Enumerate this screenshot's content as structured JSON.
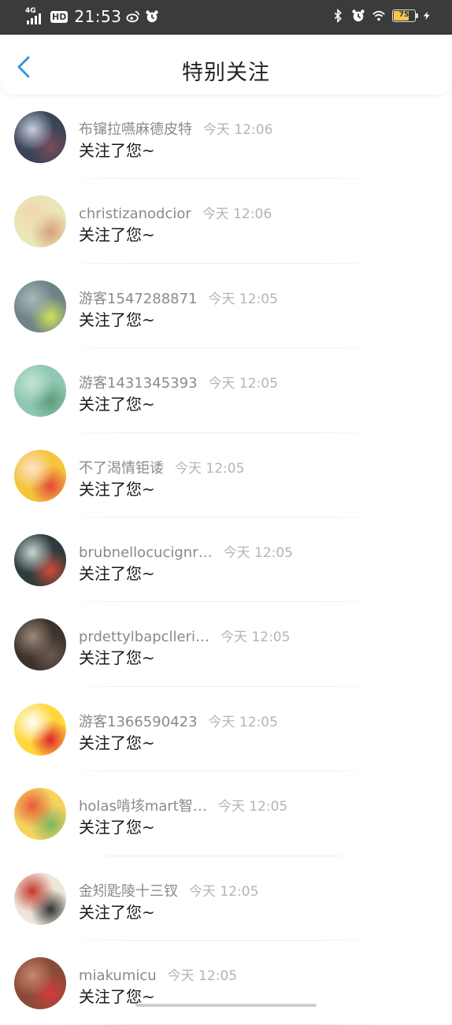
{
  "status_bar": {
    "network": "4G",
    "hd": "HD",
    "time": "21:53",
    "battery": "75",
    "battery_level": 0.75
  },
  "header": {
    "title": "特别关注"
  },
  "notifications": [
    {
      "name": "布镩拉嚥麻德皮特",
      "time": "今天 12:06",
      "message": "关注了您~"
    },
    {
      "name": "christizanodcior",
      "time": "今天 12:06",
      "message": "关注了您~"
    },
    {
      "name": "游客1547288871",
      "time": "今天 12:05",
      "message": "关注了您~"
    },
    {
      "name": "游客1431345393",
      "time": "今天 12:05",
      "message": "关注了您~"
    },
    {
      "name": "不了渴情钜诿",
      "time": "今天 12:05",
      "message": "关注了您~"
    },
    {
      "name": "brubnellocucignr…",
      "time": "今天 12:05",
      "message": "关注了您~"
    },
    {
      "name": "prdettylbapclleri…",
      "time": "今天 12:05",
      "message": "关注了您~"
    },
    {
      "name": "游客1366590423",
      "time": "今天 12:05",
      "message": "关注了您~"
    },
    {
      "name": "holas啃垓mart智…",
      "time": "今天 12:05",
      "message": "关注了您~"
    },
    {
      "name": "金矧匙陵十三钗",
      "time": "今天 12:05",
      "message": "关注了您~"
    },
    {
      "name": "miakumicu",
      "time": "今天 12:05",
      "message": "关注了您~"
    }
  ],
  "avatars": [
    {
      "icon": "avatar-dark-floral",
      "colors": [
        "#3a4458",
        "#c9cfe0",
        "#7b4a5a"
      ]
    },
    {
      "icon": "avatar-pale-flowers",
      "colors": [
        "#e9e6b8",
        "#f2d6b0",
        "#d8a07a"
      ]
    },
    {
      "icon": "avatar-grey-sprout",
      "colors": [
        "#6f8387",
        "#a9b9ba",
        "#cfe35a"
      ]
    },
    {
      "icon": "avatar-green-watercolor",
      "colors": [
        "#8fc7b2",
        "#bfe5d2",
        "#5e9d7a"
      ]
    },
    {
      "icon": "avatar-cartoon-girl",
      "colors": [
        "#f4c43a",
        "#ffe1c9",
        "#e24a3b"
      ]
    },
    {
      "icon": "avatar-window-flowers",
      "colors": [
        "#2f3b3c",
        "#c8d6d3",
        "#d24a3a"
      ]
    },
    {
      "icon": "avatar-sepia-photo",
      "colors": [
        "#3d322c",
        "#9c8a7a",
        "#6a5a50"
      ]
    },
    {
      "icon": "avatar-yellow-cat",
      "colors": [
        "#ffd93b",
        "#ffffff",
        "#e0262b"
      ]
    },
    {
      "icon": "avatar-food-cartoon",
      "colors": [
        "#f4d35e",
        "#e85a3a",
        "#7bb661"
      ]
    },
    {
      "icon": "avatar-umbrella-sketch",
      "colors": [
        "#efe5d8",
        "#c23a2c",
        "#333333"
      ]
    },
    {
      "icon": "avatar-brown-stickers",
      "colors": [
        "#8a4a3a",
        "#c7886a",
        "#d43b3b"
      ]
    }
  ]
}
